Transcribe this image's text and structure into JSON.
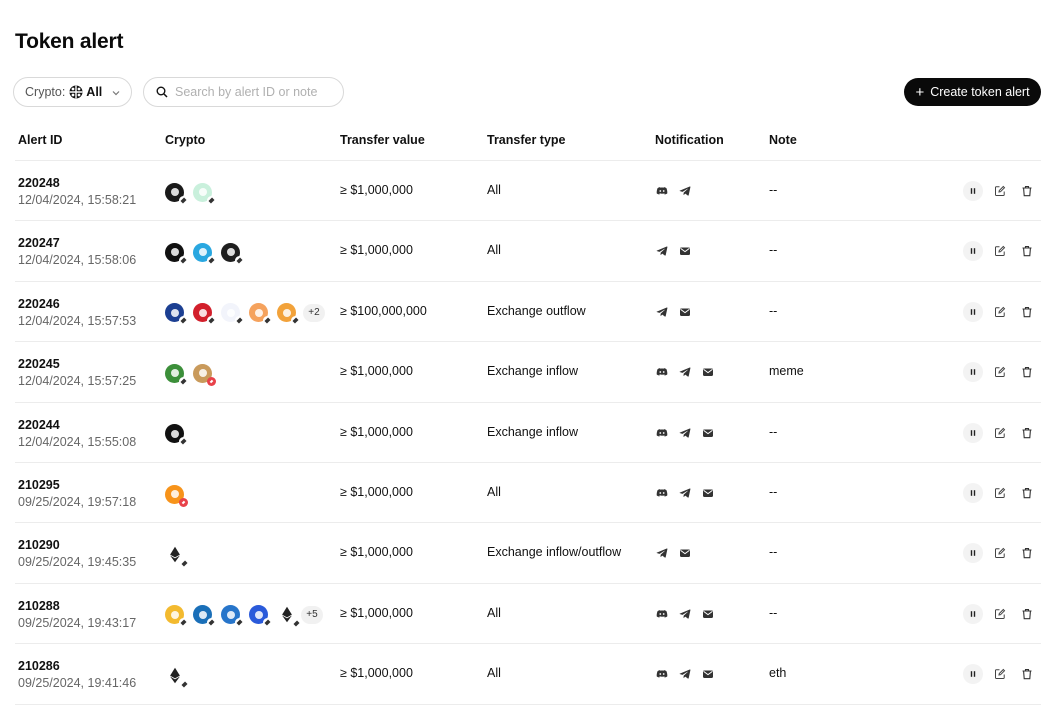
{
  "page": {
    "title": "Token alert"
  },
  "filters": {
    "crypto_label": "Crypto:",
    "crypto_value": "All",
    "search_placeholder": "Search by alert ID or note",
    "create_label": "Create token alert"
  },
  "columns": {
    "alert_id": "Alert ID",
    "crypto": "Crypto",
    "transfer_value": "Transfer value",
    "transfer_type": "Transfer type",
    "notification": "Notification",
    "note": "Note"
  },
  "colors": {
    "accent": "#0a0a0a",
    "divider": "#ececec",
    "muted_text": "#666666"
  },
  "rows": [
    {
      "id": "220248",
      "time": "12/04/2024, 15:58:21",
      "coins": [
        {
          "icon": "coin-c-icon",
          "color": "#1a1a1a",
          "chain": "eth"
        },
        {
          "icon": "coin-green-icon",
          "color": "#c9f0dc",
          "chain": "eth"
        }
      ],
      "more": "",
      "transfer_value": "≥ $1,000,000",
      "transfer_type": "All",
      "notifications": [
        "discord",
        "telegram"
      ],
      "note": "--"
    },
    {
      "id": "220247",
      "time": "12/04/2024, 15:58:06",
      "coins": [
        {
          "icon": "coin-starburst-icon",
          "color": "#111111",
          "chain": "eth"
        },
        {
          "icon": "coin-blue-icon",
          "color": "#29a7e0",
          "chain": "eth"
        },
        {
          "icon": "coin-w-icon",
          "color": "#1e1e1e",
          "chain": "eth"
        }
      ],
      "more": "",
      "transfer_value": "≥ $1,000,000",
      "transfer_type": "All",
      "notifications": [
        "telegram",
        "email"
      ],
      "note": "--"
    },
    {
      "id": "220246",
      "time": "12/04/2024, 15:57:53",
      "coins": [
        {
          "icon": "coin-hex-icon",
          "color": "#1c3f92",
          "chain": "eth"
        },
        {
          "icon": "coin-red-icon",
          "color": "#d21f2b",
          "chain": "eth"
        },
        {
          "icon": "coin-dots-icon",
          "color": "#f2f4fb",
          "chain": "eth"
        },
        {
          "icon": "coin-orange-icon",
          "color": "#f5a25d",
          "chain": "eth"
        },
        {
          "icon": "coin-yellow-icon",
          "color": "#f2a23a",
          "chain": "eth"
        }
      ],
      "more": "+2",
      "transfer_value": "≥ $100,000,000",
      "transfer_type": "Exchange outflow",
      "notifications": [
        "telegram",
        "email"
      ],
      "note": "--"
    },
    {
      "id": "220245",
      "time": "12/04/2024, 15:57:25",
      "coins": [
        {
          "icon": "coin-pepe-icon",
          "color": "#3c8f3a",
          "chain": "eth"
        },
        {
          "icon": "coin-doge-hat-icon",
          "color": "#c99a5b",
          "chain": "red"
        }
      ],
      "more": "",
      "transfer_value": "≥ $1,000,000",
      "transfer_type": "Exchange inflow",
      "notifications": [
        "discord",
        "telegram",
        "email"
      ],
      "note": "meme"
    },
    {
      "id": "220244",
      "time": "12/04/2024, 15:55:08",
      "coins": [
        {
          "icon": "coin-okb-icon",
          "color": "#111111",
          "chain": "eth"
        }
      ],
      "more": "",
      "transfer_value": "≥ $1,000,000",
      "transfer_type": "Exchange inflow",
      "notifications": [
        "discord",
        "telegram",
        "email"
      ],
      "note": "--"
    },
    {
      "id": "210295",
      "time": "09/25/2024, 19:57:18",
      "coins": [
        {
          "icon": "coin-btc-icon",
          "color": "#f7931a",
          "chain": "red"
        }
      ],
      "more": "",
      "transfer_value": "≥ $1,000,000",
      "transfer_type": "All",
      "notifications": [
        "discord",
        "telegram",
        "email"
      ],
      "note": "--"
    },
    {
      "id": "210290",
      "time": "09/25/2024, 19:45:35",
      "coins": [
        {
          "icon": "eth-icon",
          "color": "#222222",
          "chain": "eth",
          "eth": true
        }
      ],
      "more": "",
      "transfer_value": "≥ $1,000,000",
      "transfer_type": "Exchange inflow/outflow",
      "notifications": [
        "telegram",
        "email"
      ],
      "note": "--"
    },
    {
      "id": "210288",
      "time": "09/25/2024, 19:43:17",
      "coins": [
        {
          "icon": "coin-bnb-icon",
          "color": "#f3ba2f",
          "chain": "eth"
        },
        {
          "icon": "coin-v-icon",
          "color": "#1a6fb8",
          "chain": "eth"
        },
        {
          "icon": "coin-usdc-icon",
          "color": "#2775ca",
          "chain": "eth"
        },
        {
          "icon": "coin-link-icon",
          "color": "#2a5ada",
          "chain": "eth"
        },
        {
          "icon": "eth-icon",
          "color": "#222222",
          "chain": "eth",
          "eth": true
        }
      ],
      "more": "+5",
      "transfer_value": "≥ $1,000,000",
      "transfer_type": "All",
      "notifications": [
        "discord",
        "telegram",
        "email"
      ],
      "note": "--"
    },
    {
      "id": "210286",
      "time": "09/25/2024, 19:41:46",
      "coins": [
        {
          "icon": "eth-icon",
          "color": "#222222",
          "chain": "eth",
          "eth": true
        }
      ],
      "more": "",
      "transfer_value": "≥ $1,000,000",
      "transfer_type": "All",
      "notifications": [
        "discord",
        "telegram",
        "email"
      ],
      "note": "eth"
    }
  ]
}
